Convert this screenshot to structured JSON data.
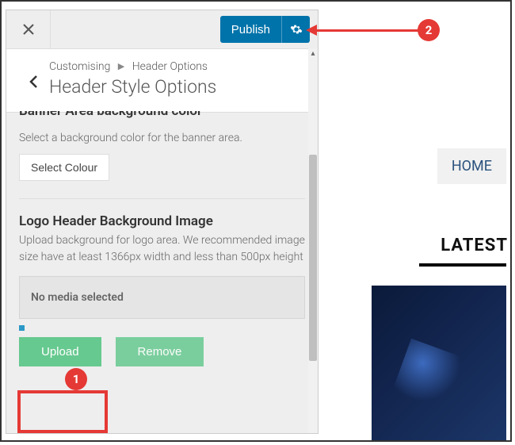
{
  "topbar": {
    "publish_label": "Publish"
  },
  "breadcrumb": {
    "root": "Customising",
    "parent": "Header Options",
    "title": "Header Style Options"
  },
  "banner_section": {
    "heading_partial": "Banner Area background color",
    "desc": "Select a background color for the banner area.",
    "select_colour_label": "Select Colour"
  },
  "logo_section": {
    "heading": "Logo Header Background Image",
    "desc": "Upload background for logo area. We recommended image size have at least 1366px width and less than 500px height",
    "no_media": "No media selected",
    "upload_label": "Upload",
    "remove_label": "Remove"
  },
  "preview": {
    "home_label": "HOME",
    "latest_label": "LATEST"
  },
  "annotations": {
    "badge1": "1",
    "badge2": "2"
  }
}
